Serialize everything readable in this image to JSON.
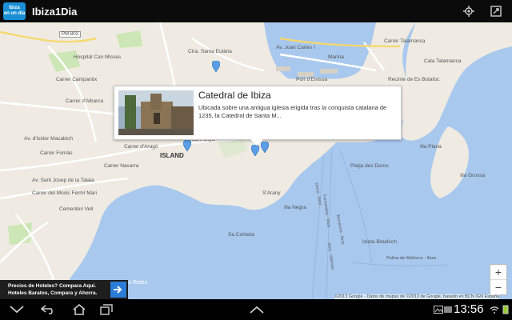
{
  "app": {
    "logo_line1": "Ibiza",
    "logo_line2": "en un día",
    "title": "Ibiza1Dia"
  },
  "actionbar_icons": [
    "locate-icon",
    "fullscreen-icon"
  ],
  "map": {
    "badge": "PM-803",
    "labels": {
      "hospital": "Hospital Can Misses",
      "carrer_campanitx": "Carrer Campanitx",
      "carrer_albarca": "Carrer d'Albarca",
      "ctra_santa": "Ctra. Santa Eulària",
      "avinguda_isidor": "Av. d'Isidor Macabich",
      "carrer_fornas": "Carrer Fornàs",
      "av_joan_carles": "Av. Joan Carles I",
      "marina": "Marina",
      "port_eivissa": "Port d'Eivissa",
      "recinte": "Recinte de Es Botafoc",
      "cala_talamanca": "Cala Talamanca",
      "carrer_talamanca": "Carrer Talamanca",
      "carrer_arago": "Carrer d'Aragó",
      "carrer_navarra": "Carrer Navarra",
      "island": "ISLAND",
      "av_sant_josep": "Av. Sant Josep de la Talaia",
      "carrer_music": "Carrer del Músic Fermí Mari",
      "cementeri": "Cementeri Vell",
      "sa_penya": "Sa Penya",
      "s_arany": "S'Arany",
      "illa_negra": "Illa Negra",
      "sa_corbeta": "Sa Corbeta",
      "illa_plana": "Illa Plana",
      "illa_grossa": "Illa Grossa",
      "platja_duros": "Platja des Duros",
      "isleta_botafoc": "Isleta Botafoch",
      "ses_rates": "Ses Rates",
      "palma_ibiza": "Palma de Mallorca - Ibiza",
      "denia_ibiza": "Denia - Ibiza",
      "formentera": "Formentera - Ibiza",
      "barcelona": "Barcelona - Ibiza",
      "valencia": "Ibiza - Valencia"
    },
    "info_window": {
      "title": "Catedral de Ibiza",
      "description": "Ubicada sobre una antigua iglesia erigida tras la conquista catalana de 1235, la Catedral de Santa M..."
    },
    "zoom": {
      "plus": "+",
      "minus": "−"
    },
    "copyright": "©2013 Google - Datos de mapas de ©2013 de Google, basado en BCN IGN España",
    "colors": {
      "water": "#a8c8ee",
      "land": "#efebe2",
      "park": "#cde6b6",
      "pin": "#5a9ee6"
    }
  },
  "ad": {
    "line1": "Precios de Hoteles? Compara Aquí.",
    "line2": "Hoteles Baratos, Compara y Ahorra."
  },
  "navbar": {
    "time": "13:56"
  }
}
